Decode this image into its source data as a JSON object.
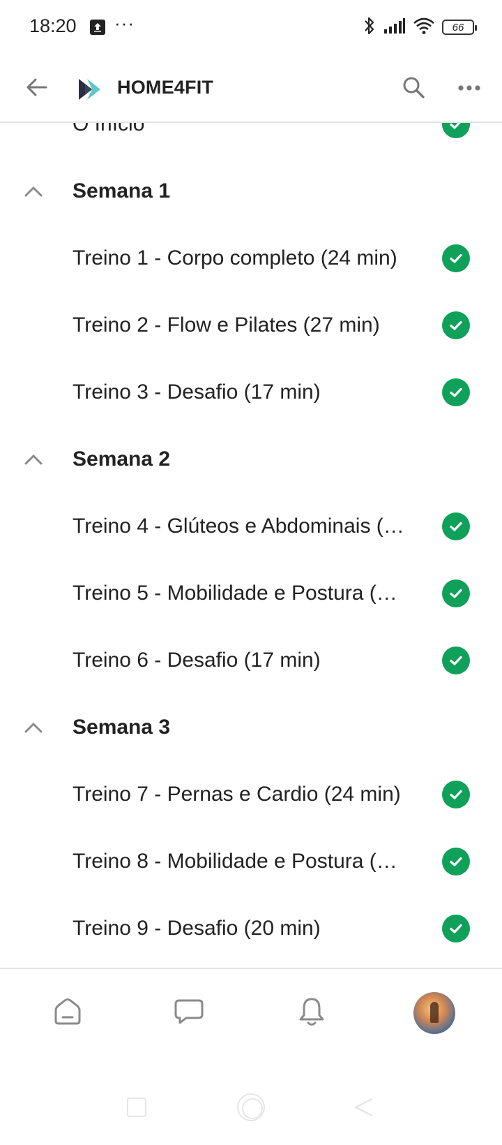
{
  "status_bar": {
    "time": "18:20",
    "dots": "···",
    "battery": "66",
    "icons": [
      "upload-icon",
      "bluetooth-icon",
      "signal-icon",
      "wifi-icon",
      "battery-icon"
    ]
  },
  "app_bar": {
    "title": "HOME4FIT",
    "icons": [
      "back-arrow-icon",
      "app-logo",
      "search-icon",
      "more-icon"
    ]
  },
  "list": [
    {
      "type": "item",
      "label": "O Início",
      "completed": true
    },
    {
      "type": "header",
      "label": "Semana 1",
      "expanded": true
    },
    {
      "type": "item",
      "label": "Treino 1 - Corpo completo (24 min)",
      "completed": true
    },
    {
      "type": "item",
      "label": "Treino 2 - Flow e Pilates (27 min)",
      "completed": true
    },
    {
      "type": "item",
      "label": "Treino 3 - Desafio (17 min)",
      "completed": true
    },
    {
      "type": "header",
      "label": "Semana 2",
      "expanded": true
    },
    {
      "type": "item",
      "label": "Treino 4 - Glúteos e Abdominais (…",
      "completed": true
    },
    {
      "type": "item",
      "label": "Treino 5 - Mobilidade e Postura (…",
      "completed": true
    },
    {
      "type": "item",
      "label": "Treino 6 - Desafio (17 min)",
      "completed": true
    },
    {
      "type": "header",
      "label": "Semana 3",
      "expanded": true
    },
    {
      "type": "item",
      "label": "Treino 7 - Pernas e Cardio (24 min)",
      "completed": true
    },
    {
      "type": "item",
      "label": "Treino 8 - Mobilidade e Postura (…",
      "completed": true
    },
    {
      "type": "item",
      "label": "Treino 9 - Desafio (20 min)",
      "completed": true
    }
  ],
  "bottom_nav": {
    "items": [
      "home-icon",
      "chat-icon",
      "bell-icon",
      "profile-avatar"
    ]
  },
  "colors": {
    "check": "#0fa15a",
    "text": "#222222",
    "icon_gray": "#8a8a8a",
    "divider": "#e4e4e4"
  }
}
